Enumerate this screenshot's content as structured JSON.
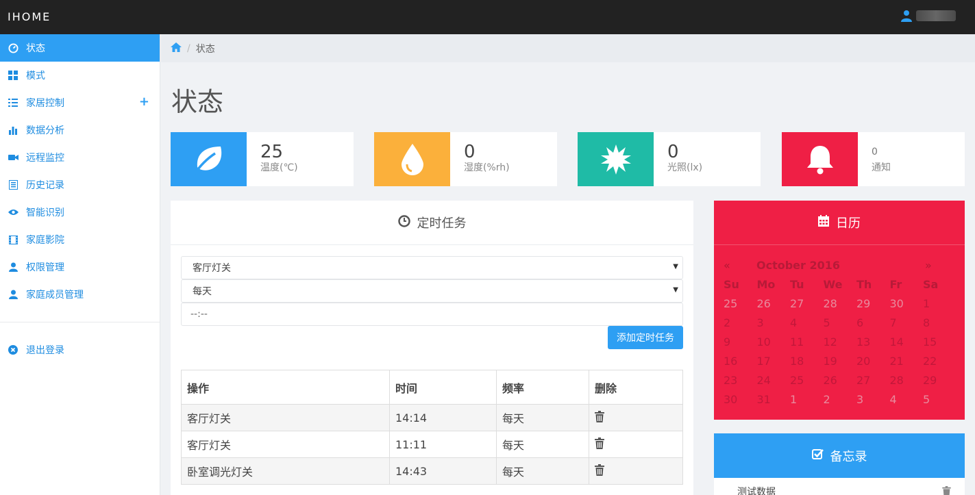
{
  "header": {
    "brand": "IHOME"
  },
  "sidebar": {
    "items": [
      {
        "label": "状态",
        "icon": "dashboard-icon"
      },
      {
        "label": "模式",
        "icon": "th-large-icon"
      },
      {
        "label": "家居控制",
        "icon": "list-icon"
      },
      {
        "label": "数据分析",
        "icon": "bar-chart-icon"
      },
      {
        "label": "远程监控",
        "icon": "video-camera-icon"
      },
      {
        "label": "历史记录",
        "icon": "list-alt-icon"
      },
      {
        "label": "智能识别",
        "icon": "eye-icon"
      },
      {
        "label": "家庭影院",
        "icon": "film-icon"
      },
      {
        "label": "权限管理",
        "icon": "user-icon"
      },
      {
        "label": "家庭成员管理",
        "icon": "user-icon"
      }
    ],
    "logout": "退出登录",
    "expand_symbol": "+"
  },
  "breadcrumb": {
    "current": "状态",
    "separator": "/"
  },
  "page": {
    "title": "状态"
  },
  "stats": [
    {
      "value": "25",
      "label": "温度(℃)",
      "color": "#2e9ff3",
      "icon": "leaf-icon"
    },
    {
      "value": "0",
      "label": "湿度(%rh)",
      "color": "#fbb03b",
      "icon": "tint-icon"
    },
    {
      "value": "0",
      "label": "光照(lx)",
      "color": "#1fbba6",
      "icon": "sun-icon"
    },
    {
      "value": "0",
      "label": "通知",
      "color": "#ef1f45",
      "icon": "bell-icon"
    }
  ],
  "tasks": {
    "title": "定时任务",
    "device_select": "客厅灯关",
    "frequency_select": "每天",
    "time_input": "--:--",
    "add_button": "添加定时任务",
    "columns": [
      "操作",
      "时间",
      "频率",
      "删除"
    ],
    "rows": [
      {
        "action": "客厅灯关",
        "time": "14:14",
        "freq": "每天"
      },
      {
        "action": "客厅灯关",
        "time": "11:11",
        "freq": "每天"
      },
      {
        "action": "卧室调光灯关",
        "time": "14:43",
        "freq": "每天"
      }
    ]
  },
  "calendar": {
    "title": "日历",
    "month": "October 2016",
    "prev": "«",
    "next": "»",
    "weekdays": [
      "Su",
      "Mo",
      "Tu",
      "We",
      "Th",
      "Fr",
      "Sa"
    ],
    "weeks": [
      [
        "25",
        "26",
        "27",
        "28",
        "29",
        "30",
        "1"
      ],
      [
        "2",
        "3",
        "4",
        "5",
        "6",
        "7",
        "8"
      ],
      [
        "9",
        "10",
        "11",
        "12",
        "13",
        "14",
        "15"
      ],
      [
        "16",
        "17",
        "18",
        "19",
        "20",
        "21",
        "22"
      ],
      [
        "23",
        "24",
        "25",
        "26",
        "27",
        "28",
        "29"
      ],
      [
        "30",
        "31",
        "1",
        "2",
        "3",
        "4",
        "5"
      ]
    ]
  },
  "memo": {
    "title": "备忘录",
    "items": [
      "测试数据"
    ]
  }
}
